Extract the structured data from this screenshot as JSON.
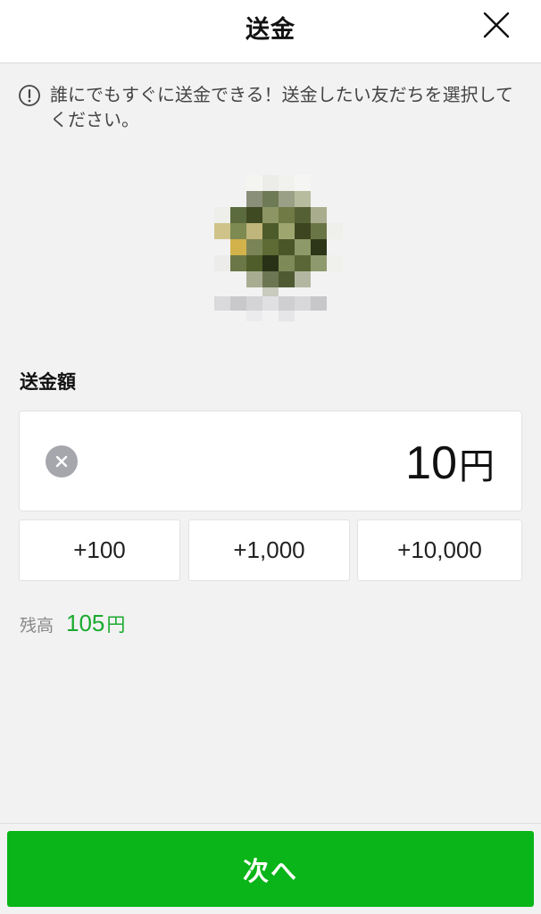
{
  "header": {
    "title": "送金",
    "close_icon": "close-icon"
  },
  "notice": {
    "icon": "info-icon",
    "text": "誰にでもすぐに送金できる！送金したい友だちを選択してください。"
  },
  "amount": {
    "label": "送金額",
    "value": "10",
    "currency": "円",
    "clear_icon": "clear-icon"
  },
  "quick_add": [
    {
      "label": "+100"
    },
    {
      "label": "+1,000"
    },
    {
      "label": "+10,000"
    }
  ],
  "balance": {
    "label": "残高",
    "value": "105",
    "currency": "円"
  },
  "next_button": {
    "label": "次へ"
  },
  "colors": {
    "accent": "#09b518",
    "balance_green": "#1aaa2e",
    "background": "#f2f2f3"
  }
}
